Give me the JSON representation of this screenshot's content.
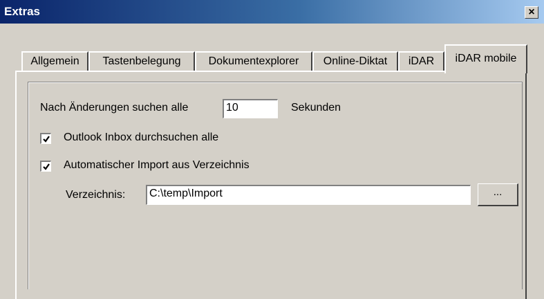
{
  "window": {
    "title": "Extras",
    "close_label": "×"
  },
  "tabs": [
    {
      "label": "Allgemein",
      "active": false
    },
    {
      "label": "Tastenbelegung",
      "active": false
    },
    {
      "label": "Dokumentexplorer",
      "active": false
    },
    {
      "label": "Online-Diktat",
      "active": false
    },
    {
      "label": "iDAR",
      "active": false
    },
    {
      "label": "iDAR mobile",
      "active": true
    }
  ],
  "settings": {
    "interval_label": "Nach Änderungen suchen alle",
    "interval_value": "10",
    "interval_unit": "Sekunden",
    "outlook_label": "Outlook Inbox durchsuchen alle",
    "outlook_checked": true,
    "auto_import_label": "Automatischer Import aus Verzeichnis",
    "auto_import_checked": true,
    "directory_label": "Verzeichnis:",
    "directory_value": "C:\\temp\\Import",
    "browse_label": "..."
  }
}
